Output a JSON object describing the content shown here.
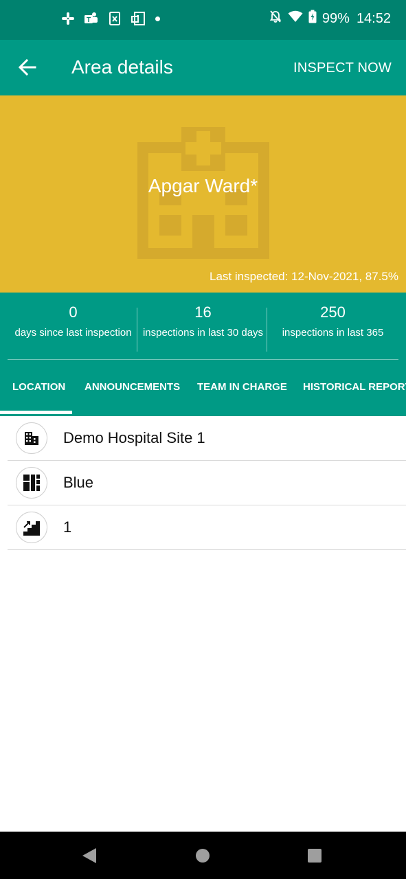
{
  "status_bar": {
    "notification_icons": [
      "slack-icon",
      "teams-icon",
      "excel-icon",
      "app-icon",
      "dot-icon"
    ],
    "system_icons": [
      "mute-icon",
      "wifi-icon",
      "battery-charging-icon"
    ],
    "battery": "99%",
    "time": "14:52"
  },
  "app_bar": {
    "title": "Area details",
    "action": "INSPECT NOW",
    "back_icon": "arrow-back-icon"
  },
  "hero": {
    "title": "Apgar Ward*",
    "last_inspected": "Last inspected: 12-Nov-2021, 87.5%",
    "background_icon": "hospital-icon",
    "color": "#e4b92f"
  },
  "stats": [
    {
      "value": "0",
      "label": "days since last inspection"
    },
    {
      "value": "16",
      "label": "inspections in last 30 days"
    },
    {
      "value": "250",
      "label": "inspections in last 365"
    }
  ],
  "tabs": [
    {
      "label": "LOCATION",
      "selected": true
    },
    {
      "label": "ANNOUNCEMENTS",
      "selected": false
    },
    {
      "label": "TEAM IN CHARGE",
      "selected": false
    },
    {
      "label": "HISTORICAL REPORTS",
      "selected": false
    }
  ],
  "location": [
    {
      "icon": "building-icon",
      "label": "Demo Hospital Site 1"
    },
    {
      "icon": "floor-plan-icon",
      "label": "Blue"
    },
    {
      "icon": "stairs-icon",
      "label": "1"
    }
  ],
  "colors": {
    "status_bar": "#00826f",
    "primary": "#009a85",
    "hero": "#e4b92f"
  }
}
